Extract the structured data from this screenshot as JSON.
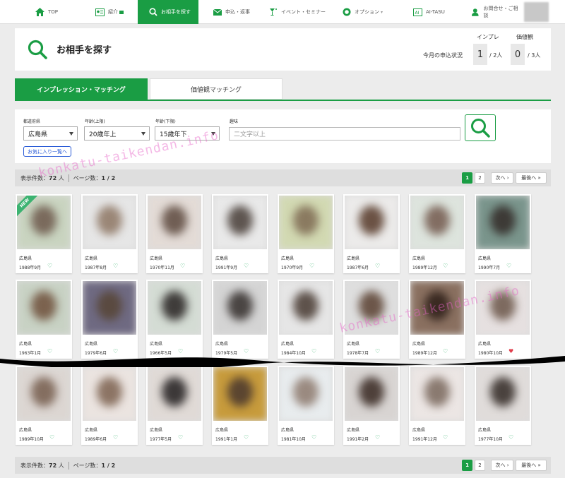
{
  "nav": {
    "items": [
      {
        "label": "TOP",
        "icon": "home-icon"
      },
      {
        "label": "紹介",
        "icon": "profile-card-icon"
      },
      {
        "label": "お相手を探す",
        "icon": "search-icon",
        "active": true
      },
      {
        "label": "申込・返事",
        "icon": "mail-icon"
      },
      {
        "label": "イベント・セミナー",
        "icon": "event-glass-icon"
      },
      {
        "label": "オプション",
        "icon": "badge-icon"
      },
      {
        "label": "AI-TASU",
        "icon": "ai-book-icon"
      },
      {
        "label": "お問合せ・ご相談",
        "icon": "support-icon"
      }
    ]
  },
  "header": {
    "title": "お相手を探す",
    "status_label": "今月の申込状況",
    "stats": [
      {
        "heading": "インプレ",
        "value": "1",
        "total": "/ 2人"
      },
      {
        "heading": "価値観",
        "value": "0",
        "total": "/ 3人"
      }
    ]
  },
  "tabs": [
    {
      "label": "インプレッション・マッチング",
      "active": true
    },
    {
      "label": "価値観マッチング",
      "active": false
    }
  ],
  "search": {
    "prefecture_label": "都道府県",
    "prefecture_value": "広島県",
    "age_min_label": "年齢(上限)",
    "age_min_value": "20歳年上",
    "age_max_label": "年齢(下限)",
    "age_max_value": "15歳年下",
    "hobby_label": "趣味",
    "hobby_placeholder": "二文字以上",
    "favorites_label": "お気に入り一覧へ"
  },
  "results": {
    "count_label": "表示件数：",
    "count_value": "72",
    "count_unit": "人",
    "page_label": "ページ数：",
    "page_value": "1 / 2",
    "pages": [
      "1",
      "2"
    ],
    "next_label": "次へ ›",
    "last_label": "最後へ »"
  },
  "watermark": "konkatu-taikendan.info",
  "profiles": [
    {
      "pref": "広島県",
      "birth": "1988年9月",
      "fav": false,
      "new": true,
      "bg": "#c9d4c0",
      "face": "#7a6a5c"
    },
    {
      "pref": "広島県",
      "birth": "1987年8月",
      "fav": false,
      "bg": "#e6e6e6",
      "face": "#9a8676"
    },
    {
      "pref": "広島県",
      "birth": "1970年11月",
      "fav": false,
      "bg": "#e3dbd6",
      "face": "#705e54"
    },
    {
      "pref": "広島県",
      "birth": "1991年9月",
      "fav": false,
      "bg": "#e9e9e9",
      "face": "#5e5550"
    },
    {
      "pref": "広島県",
      "birth": "1970年9月",
      "fav": false,
      "bg": "#d2d9b2",
      "face": "#8a7a60"
    },
    {
      "pref": "広島県",
      "birth": "1987年6月",
      "fav": false,
      "bg": "#ecebea",
      "face": "#6b5244"
    },
    {
      "pref": "広島県",
      "birth": "1989年12月",
      "fav": false,
      "bg": "#dde4dd",
      "face": "#826d62"
    },
    {
      "pref": "広島県",
      "birth": "1990年7月",
      "fav": false,
      "bg": "#7a958c",
      "face": "#3d3a36"
    },
    {
      "pref": "広島県",
      "birth": "1963年1月",
      "fav": false,
      "bg": "#c8d2c4",
      "face": "#7b624e"
    },
    {
      "pref": "広島県",
      "birth": "1979年6月",
      "fav": false,
      "bg": "#6f6a82",
      "face": "#5a4a40"
    },
    {
      "pref": "広島県",
      "birth": "1966年5月",
      "fav": false,
      "bg": "#d4dcd4",
      "face": "#3f3c3a"
    },
    {
      "pref": "広島県",
      "birth": "1979年5月",
      "fav": false,
      "bg": "#d4d4d4",
      "face": "#4a4543"
    },
    {
      "pref": "広島県",
      "birth": "1984年10月",
      "fav": false,
      "bg": "#e6e6e6",
      "face": "#5e524b"
    },
    {
      "pref": "広島県",
      "birth": "1978年7月",
      "fav": false,
      "bg": "#dedede",
      "face": "#6c5649"
    },
    {
      "pref": "広島県",
      "birth": "1989年12月",
      "fav": false,
      "bg": "#8a7060",
      "face": "#3a2a22"
    },
    {
      "pref": "広島県",
      "birth": "1980年10月",
      "fav": true,
      "bg": "#e6e0e0",
      "face": "#7d6a5f"
    },
    {
      "pref": "広島県",
      "birth": "1989年10月",
      "fav": false,
      "bg": "#dcd6d2",
      "face": "#846e60"
    },
    {
      "pref": "広島県",
      "birth": "1989年6月",
      "fav": false,
      "bg": "#ebe4e0",
      "face": "#8c7464"
    },
    {
      "pref": "広島県",
      "birth": "1977年5月",
      "fav": false,
      "bg": "#e0dad6",
      "face": "#3c3838"
    },
    {
      "pref": "広島県",
      "birth": "1991年1月",
      "fav": false,
      "bg": "#c79b3c",
      "face": "#5b4530"
    },
    {
      "pref": "広島県",
      "birth": "1981年10月",
      "fav": false,
      "bg": "#e8ecee",
      "face": "#9a8a80"
    },
    {
      "pref": "広島県",
      "birth": "1991年2月",
      "fav": false,
      "bg": "#d8d4d2",
      "face": "#4e403a"
    },
    {
      "pref": "広島県",
      "birth": "1991年12月",
      "fav": false,
      "bg": "#ece6e4",
      "face": "#8a7a70"
    },
    {
      "pref": "広島県",
      "birth": "1977年10月",
      "fav": false,
      "bg": "#e0dcda",
      "face": "#4a423e"
    }
  ],
  "colors": {
    "brand": "#1a9d44",
    "link": "#2a5bd7",
    "heart_outline": "#3cb371",
    "heart_filled": "#e03c4a"
  }
}
